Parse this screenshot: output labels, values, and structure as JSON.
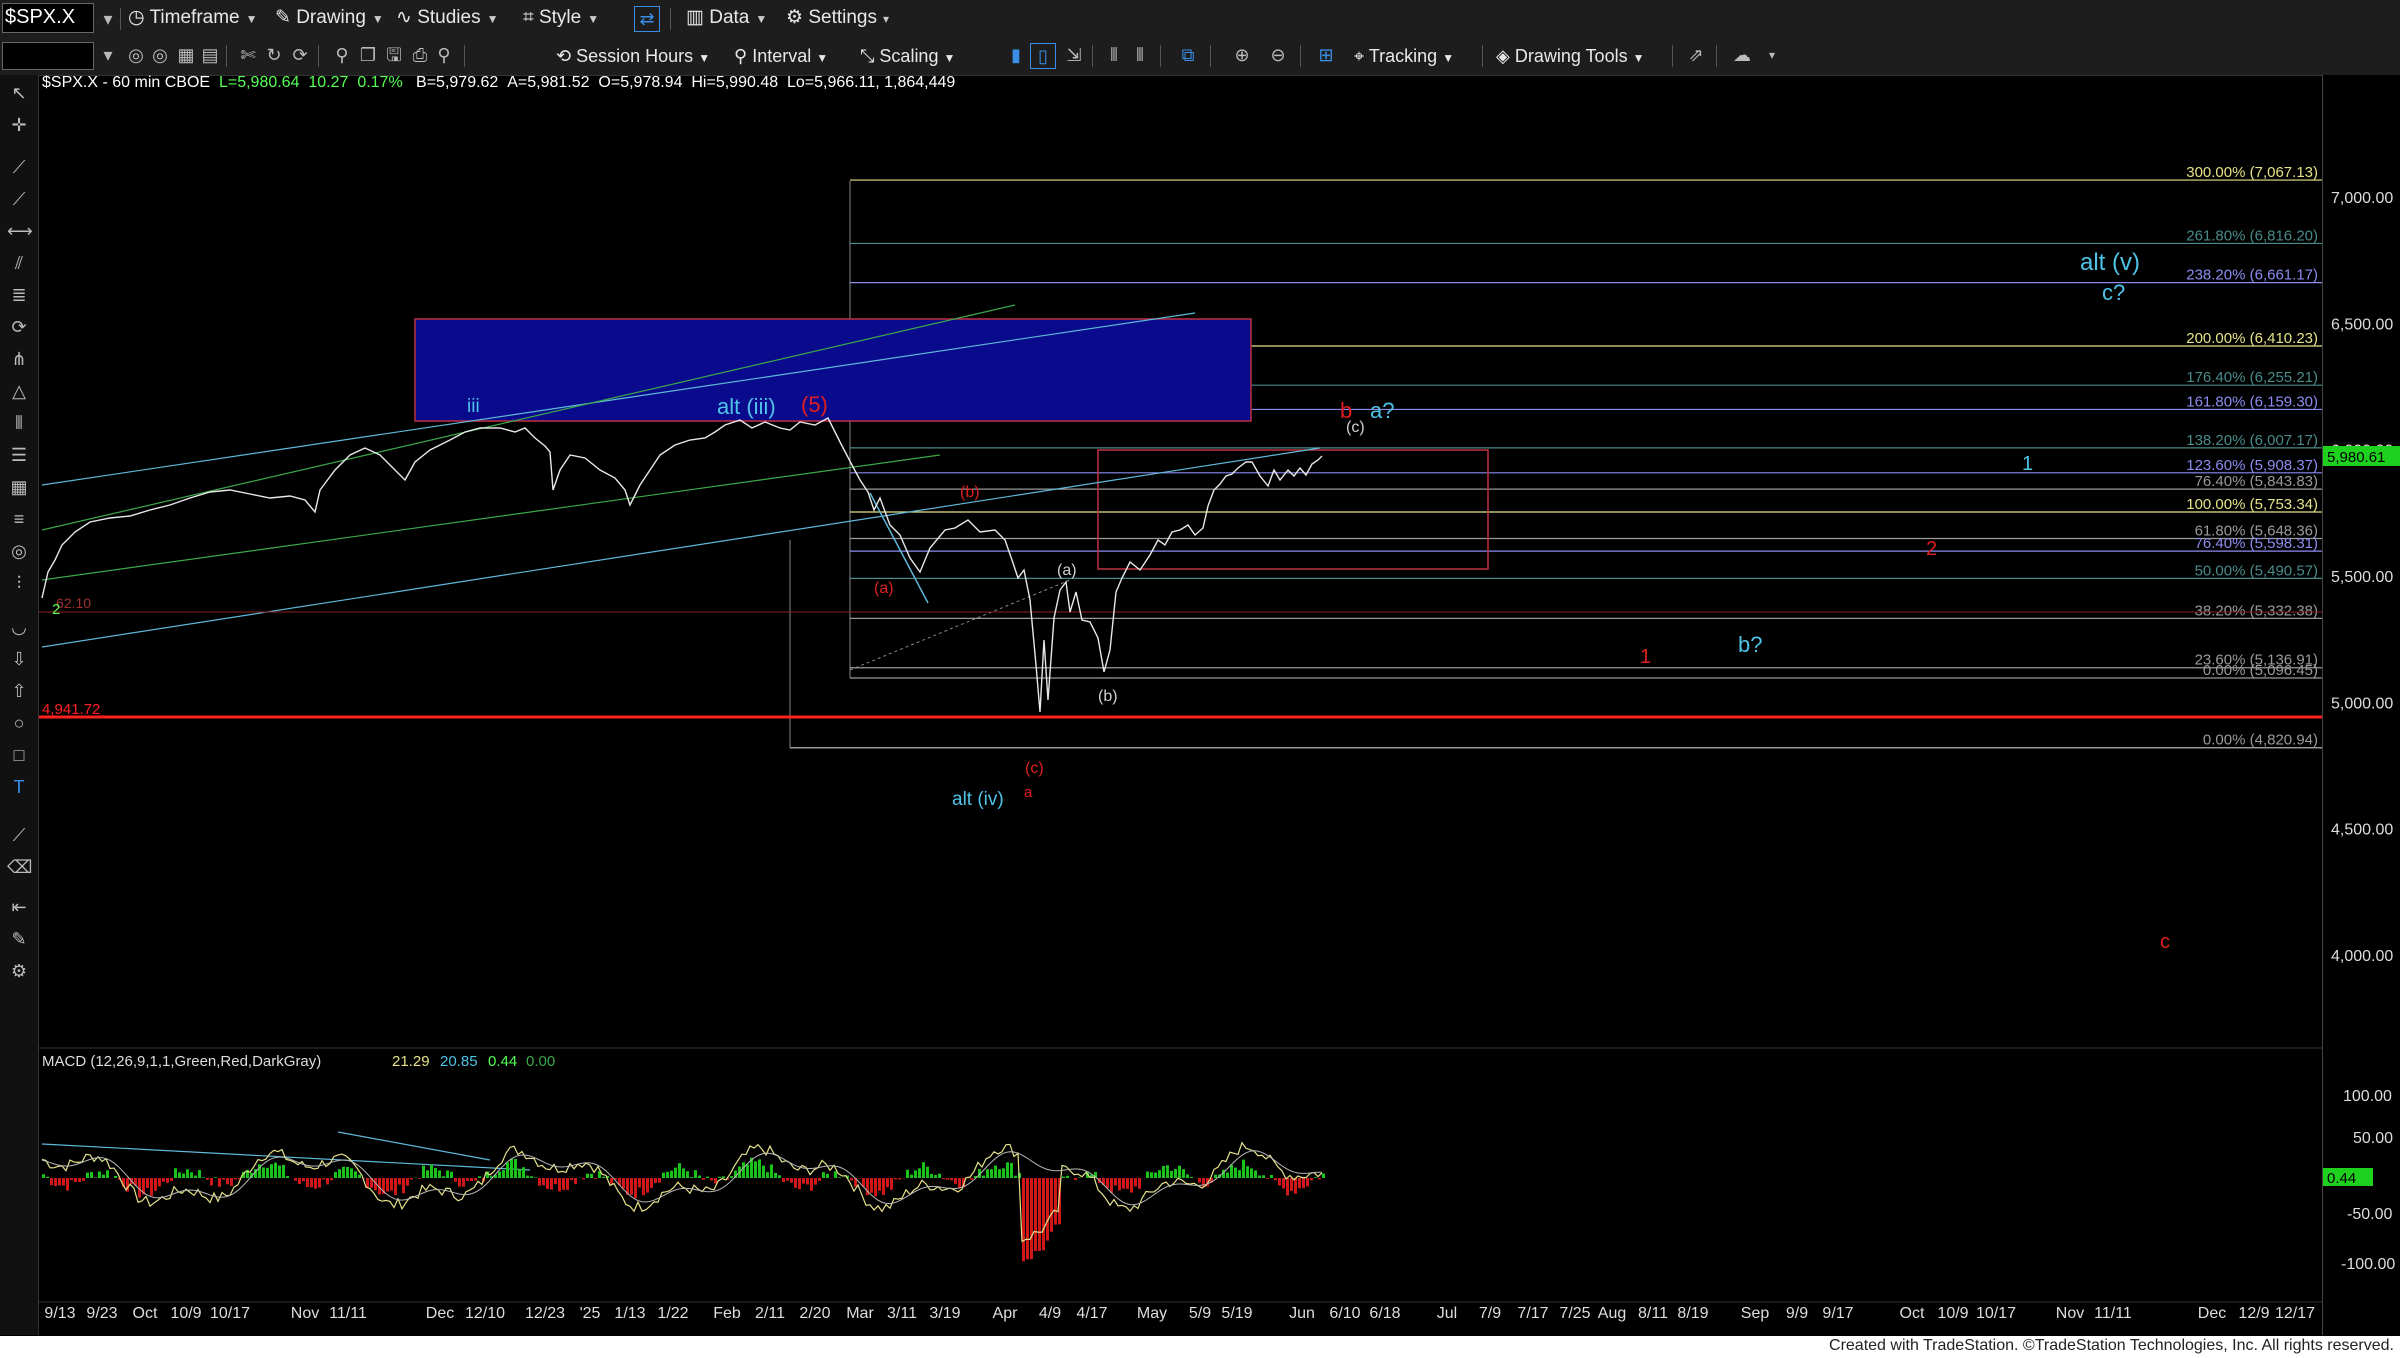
{
  "toolbar": {
    "symbol": "$SPX.X",
    "menu": [
      "Timeframe",
      "Drawing",
      "Studies",
      "Style",
      "Data",
      "Settings"
    ],
    "session_hours": "Session Hours",
    "interval": "Interval",
    "scaling": "Scaling",
    "tracking": "Tracking",
    "drawing_tools": "Drawing Tools"
  },
  "chart_info": {
    "title": "$SPX.X - 60 min  CBOE",
    "last": "L=5,980.64",
    "change": "10.27",
    "change_pct": "0.17%",
    "bid": "B=5,979.62",
    "ask": "A=5,981.52",
    "open": "O=5,978.94",
    "high": "Hi=5,990.48",
    "low": "Lo=5,966.11",
    "volume": "1,864,449"
  },
  "price_axis": {
    "ticks": [
      "7,000.00",
      "6,500.00",
      "6,000.00",
      "5,500.00",
      "5,000.00",
      "4,500.00",
      "4,000.00"
    ],
    "last_price_label": "5,980.61",
    "last_price_color": "#1fd11f"
  },
  "macd": {
    "label": "MACD (12,26,9,1,1,Green,Red,DarkGray)",
    "v1": "21.29",
    "v2": "20.85",
    "v3": "0.44",
    "v4": "0.00",
    "axis_ticks": [
      "100.00",
      "50.00",
      "-50.00",
      "-100.00"
    ],
    "current_label": "0.44"
  },
  "x_axis": {
    "ticks": [
      "9/13",
      "9/23",
      "Oct",
      "10/9",
      "10/17",
      "Nov",
      "11/11",
      "Dec",
      "12/10",
      "12/23",
      "'25",
      "1/13",
      "1/22",
      "Feb",
      "2/11",
      "2/20",
      "Mar",
      "3/11",
      "3/19",
      "Apr",
      "4/9",
      "4/17",
      "May",
      "5/9",
      "5/19",
      "Jun",
      "6/10",
      "6/18",
      "Jul",
      "7/9",
      "7/17",
      "7/25",
      "Aug",
      "8/11",
      "8/19",
      "Sep",
      "9/9",
      "9/17",
      "Oct",
      "10/9",
      "10/17",
      "Nov",
      "11/11",
      "Dec",
      "12/9",
      "12/17"
    ]
  },
  "fib_levels": [
    {
      "text": "300.00% (7,067.13)",
      "color": "#e5e28a",
      "price": 7067.13
    },
    {
      "text": "261.80% (6,816.20)",
      "color": "#4a8a8a",
      "price": 6816.2
    },
    {
      "text": "238.20% (6,661.17)",
      "color": "#8c8cf0",
      "price": 6661.17
    },
    {
      "text": "200.00% (6,410.23)",
      "color": "#e5e28a",
      "price": 6410.23
    },
    {
      "text": "176.40% (6,255.21)",
      "color": "#4a8a8a",
      "price": 6255.21
    },
    {
      "text": "161.80% (6,159.30)",
      "color": "#8c8cf0",
      "price": 6159.3
    },
    {
      "text": "138.20% (6,007.17)",
      "color": "#4a8a8a",
      "price": 6007.17
    },
    {
      "text": "123.60% (5,908.37)",
      "color": "#8c8cf0",
      "price": 5908.37
    },
    {
      "text": "76.40% (5,843.83)",
      "color": "#9a9a9a",
      "price": 5843.83
    },
    {
      "text": "100.00% (5,753.34)",
      "color": "#e5e28a",
      "price": 5753.34
    },
    {
      "text": "61.80% (5,648.36)",
      "color": "#9a9a9a",
      "price": 5648.36
    },
    {
      "text": "76.40% (5,598.31)",
      "color": "#8c8cf0",
      "price": 5598.31
    },
    {
      "text": "50.00% (5,490.57)",
      "color": "#4a8a8a",
      "price": 5490.57
    },
    {
      "text": "38.20% (5,332.38)",
      "color": "#9a9a9a",
      "price": 5332.38
    },
    {
      "text": "23.60% (5,136.91)",
      "color": "#9a9a9a",
      "price": 5136.91
    },
    {
      "text": "0.00% (5,096.45)",
      "color": "#9a9a9a",
      "price": 5096.45
    },
    {
      "text": "0.00% (4,820.94)",
      "color": "#9a9a9a",
      "price": 4820.94
    }
  ],
  "support_line": {
    "label": "4,941.72",
    "price": 4941.72,
    "color": "#ff2020"
  },
  "wave_labels": [
    {
      "text": "iii",
      "color": "#4fc3e8"
    },
    {
      "text": "alt (iii)",
      "color": "#4fc3e8"
    },
    {
      "text": "(5)",
      "color": "#e02020"
    },
    {
      "text": "(a)",
      "color": "#e02020"
    },
    {
      "text": "(b)",
      "color": "#e02020"
    },
    {
      "text": "(a)",
      "color": "#cfcfcf"
    },
    {
      "text": "(b)",
      "color": "#cfcfcf"
    },
    {
      "text": "(c)",
      "color": "#e02020"
    },
    {
      "text": "a",
      "color": "#e02020"
    },
    {
      "text": "alt (iv)",
      "color": "#4fc3e8"
    },
    {
      "text": "(c)",
      "color": "#cfcfcf"
    },
    {
      "text": "b",
      "color": "#e02020"
    },
    {
      "text": "a?",
      "color": "#4fc3e8"
    },
    {
      "text": "alt (v)",
      "color": "#4fc3e8"
    },
    {
      "text": "c?",
      "color": "#4fc3e8"
    },
    {
      "text": "1",
      "color": "#4fc3e8"
    },
    {
      "text": "2",
      "color": "#e02020"
    },
    {
      "text": "1",
      "color": "#e02020"
    },
    {
      "text": "b?",
      "color": "#4fc3e8"
    },
    {
      "text": "c",
      "color": "#e02020"
    },
    {
      "text": "2",
      "color": "#5f5"
    }
  ],
  "footer": "Created with TradeStation. ©TradeStation Technologies, Inc. All rights reserved."
}
